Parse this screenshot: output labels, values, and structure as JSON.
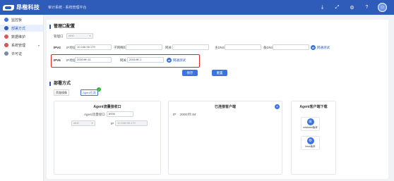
{
  "app": {
    "brand": "昂楷科技",
    "system_title": "审计系统 - 系统管理平台"
  },
  "topbar": {
    "icons": [
      "download-icon",
      "fullscreen-icon",
      "settings-icon",
      "help-icon",
      "user-icon"
    ]
  },
  "sidebar": {
    "items": [
      {
        "label": "监控板",
        "icon": "monitor-icon",
        "active": false
      },
      {
        "label": "部署方式",
        "icon": "deploy-icon",
        "active": true
      },
      {
        "label": "数据维护",
        "icon": "database-icon",
        "active": false
      },
      {
        "label": "系统管理",
        "icon": "system-icon",
        "active": false,
        "has_caret": true
      },
      {
        "label": "许可证",
        "icon": "license-icon",
        "active": false
      }
    ]
  },
  "mgmt_config": {
    "title": "管理口配置",
    "port_label": "管理口",
    "port_value": "eth0",
    "ipv4": {
      "label": "IPV4",
      "ip_label": "IP地址",
      "ip_value": "10.246.98.179",
      "mask_label": "子网掩码",
      "mask_value": "",
      "gateway_label": "网关",
      "gateway_value": "",
      "dns1_label": "主DNS",
      "dns1_value": "",
      "dns2_label": "备DNS",
      "dns2_value": "",
      "ping_label": "网通测试"
    },
    "ipv6": {
      "label": "IPV6",
      "ip_label": "IP地址",
      "ip_value": "2000:fff::41",
      "gateway_label": "网关",
      "gateway_value": "2000:fff::1",
      "ping_label": "网通测试"
    },
    "save_label": "保存",
    "reset_label": "重置"
  },
  "deploy": {
    "title": "部署方式",
    "tabs": [
      {
        "label": "旁路镜像",
        "selected": false
      },
      {
        "label": "Agent引流",
        "selected": true
      }
    ],
    "agent_port_panel": {
      "title": "Agent流量接收口",
      "port_label": "Agent流量接口",
      "port_value": "8006",
      "interface_value": "eth0",
      "ip_label": "IP",
      "ip_value": "10.246.98.179"
    },
    "deployed_panel": {
      "title": "已连接客户端",
      "client_label": "IP",
      "client_value": "2000:fff::84"
    },
    "download_panel": {
      "title": "Agent客户端下载",
      "windows_label": "windows版本",
      "linux_label": "linux版本"
    }
  }
}
